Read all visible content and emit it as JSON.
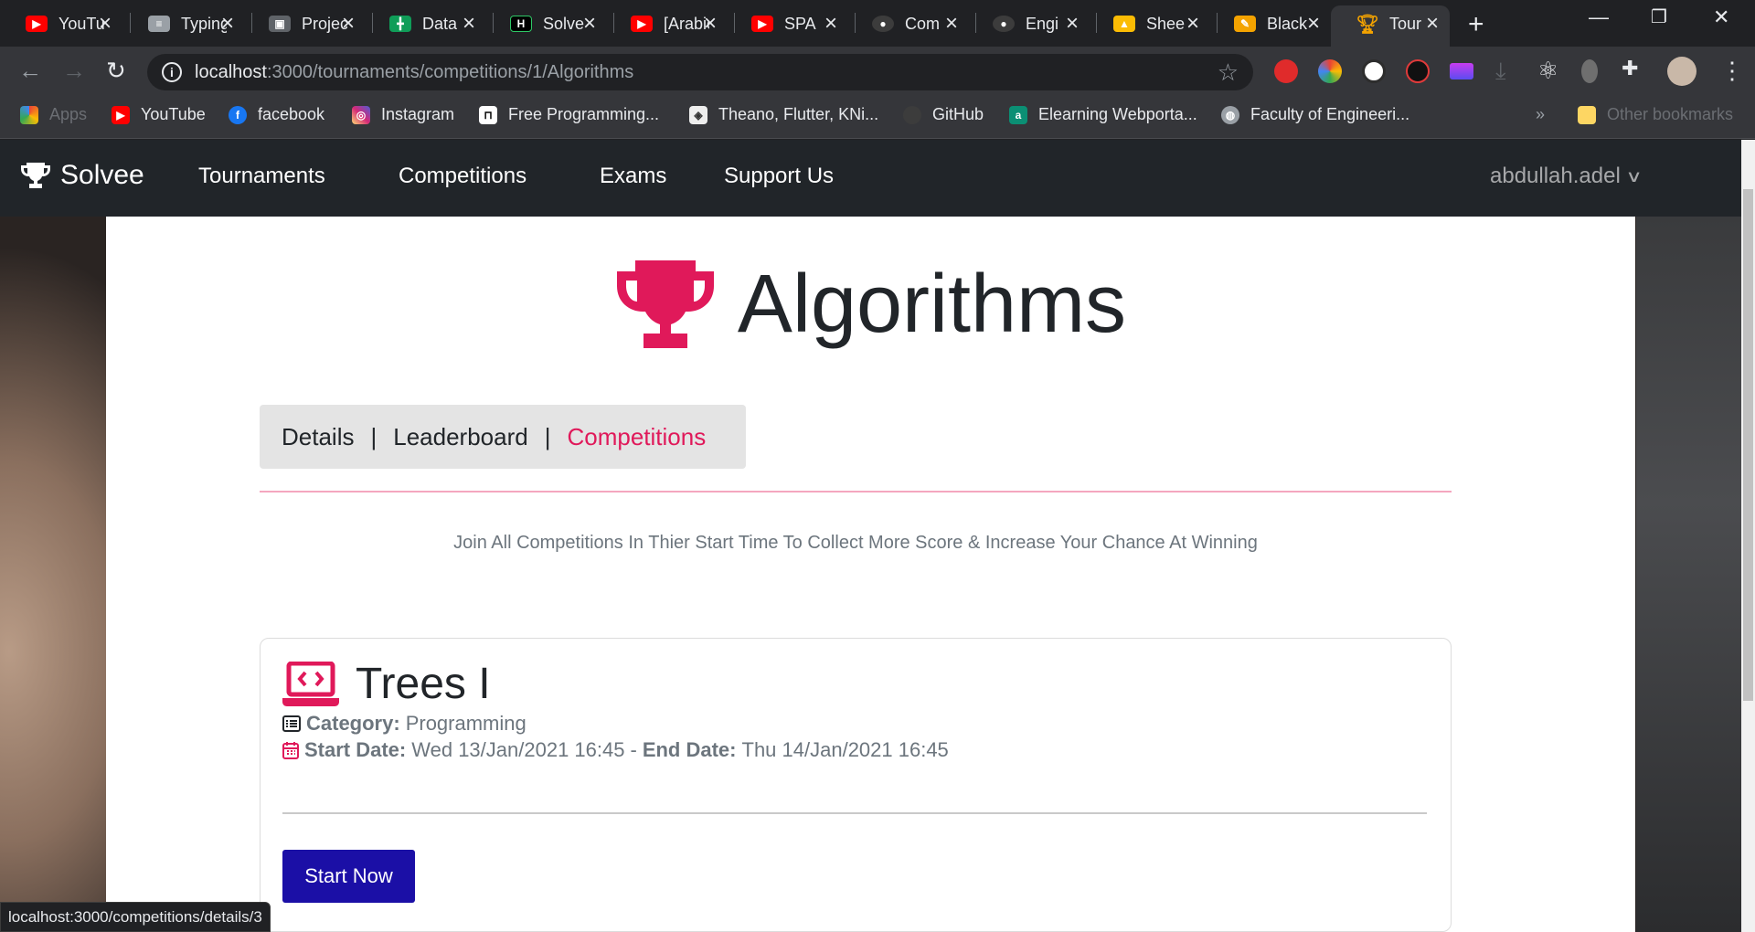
{
  "browser": {
    "tabs": [
      {
        "title": "YouTube",
        "icon": "youtube-icon",
        "color": "#ff0000"
      },
      {
        "title": "Typing",
        "icon": "document-icon",
        "color": "#9aa0a6"
      },
      {
        "title": "Projects",
        "icon": "classroom-icon",
        "color": "#5f6368"
      },
      {
        "title": "Data",
        "icon": "sheets-icon",
        "color": "#0f9d58"
      },
      {
        "title": "Solve",
        "icon": "hackerrank-icon",
        "color": "#000000"
      },
      {
        "title": "[Arabic",
        "icon": "youtube-icon",
        "color": "#ff0000"
      },
      {
        "title": "SPA",
        "icon": "youtube-icon",
        "color": "#ff0000"
      },
      {
        "title": "Com",
        "icon": "github-icon",
        "color": "#3c3c3c"
      },
      {
        "title": "Engi",
        "icon": "github-icon",
        "color": "#3c3c3c"
      },
      {
        "title": "Shee",
        "icon": "drive-icon",
        "color": "#fbbc04"
      },
      {
        "title": "Black",
        "icon": "notes-icon",
        "color": "#f4a300"
      },
      {
        "title": "Tour",
        "icon": "trophy-icon",
        "color": "#f4a300"
      }
    ],
    "url_host": "localhost",
    "url_rest": ":3000/tournaments/competitions/1/Algorithms",
    "bookmarks": [
      {
        "label": "Apps",
        "icon": "apps-icon"
      },
      {
        "label": "YouTube",
        "icon": "youtube-icon"
      },
      {
        "label": "facebook",
        "icon": "facebook-icon"
      },
      {
        "label": "Instagram",
        "icon": "instagram-icon"
      },
      {
        "label": "Free Programming...",
        "icon": "freecodecamp-icon"
      },
      {
        "label": "Theano, Flutter, KNi...",
        "icon": "site-icon"
      },
      {
        "label": "GitHub",
        "icon": "github-icon"
      },
      {
        "label": "Elearning Webporta...",
        "icon": "elearning-icon"
      },
      {
        "label": "Faculty of Engineeri...",
        "icon": "globe-icon"
      }
    ],
    "overflow": "»",
    "other_bookmarks": "Other bookmarks",
    "status_url": "localhost:3000/competitions/details/3"
  },
  "site": {
    "brand": "Solvee",
    "nav": [
      "Tournaments",
      "Competitions",
      "Exams",
      "Support Us"
    ],
    "user": "abdullah.adel",
    "accent": "#e0195a"
  },
  "tournament": {
    "title": "Algorithms",
    "tabs": [
      {
        "label": "Details",
        "active": false
      },
      {
        "label": "Leaderboard",
        "active": false
      },
      {
        "label": "Competitions",
        "active": true
      }
    ],
    "separator": "|",
    "info": "Join All Competitions In Thier Start Time To Collect More Score & Increase Your Chance At Winning"
  },
  "competition": {
    "title": "Trees I",
    "category_label": "Category:",
    "category": "Programming",
    "start_label": "Start Date:",
    "start": "Wed 13/Jan/2021 16:45",
    "dash": "-",
    "end_label": "End Date:",
    "end": "Thu 14/Jan/2021 16:45",
    "button": "Start Now",
    "button_color": "#1b0fa6"
  }
}
